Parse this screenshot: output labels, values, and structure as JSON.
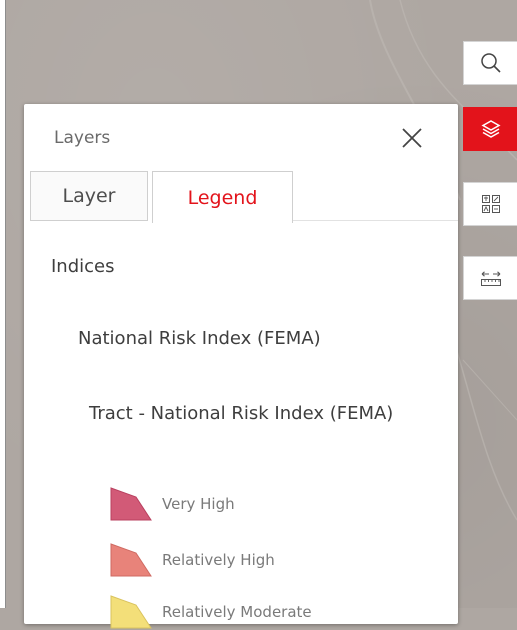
{
  "panel": {
    "title": "Layers",
    "tabs": [
      {
        "label": "Layer",
        "active": false
      },
      {
        "label": "Legend",
        "active": true
      }
    ]
  },
  "legend": {
    "group": "Indices",
    "layer": "National Risk Index (FEMA)",
    "sublayer": "Tract - National Risk Index (FEMA)",
    "items": [
      {
        "label": "Very High",
        "color": "#d25a77"
      },
      {
        "label": "Relatively High",
        "color": "#e8837a"
      },
      {
        "label": "Relatively Moderate",
        "color": "#f3df79"
      }
    ]
  },
  "toolbar": {
    "tools": [
      {
        "name": "search",
        "icon": "search-icon"
      },
      {
        "name": "layers",
        "icon": "layers-icon",
        "active": true
      },
      {
        "name": "basemap",
        "icon": "basemap-gallery-icon"
      },
      {
        "name": "measure",
        "icon": "measure-icon"
      }
    ]
  },
  "colors": {
    "accent": "#e3131b",
    "map_background": "#aea7a2"
  }
}
